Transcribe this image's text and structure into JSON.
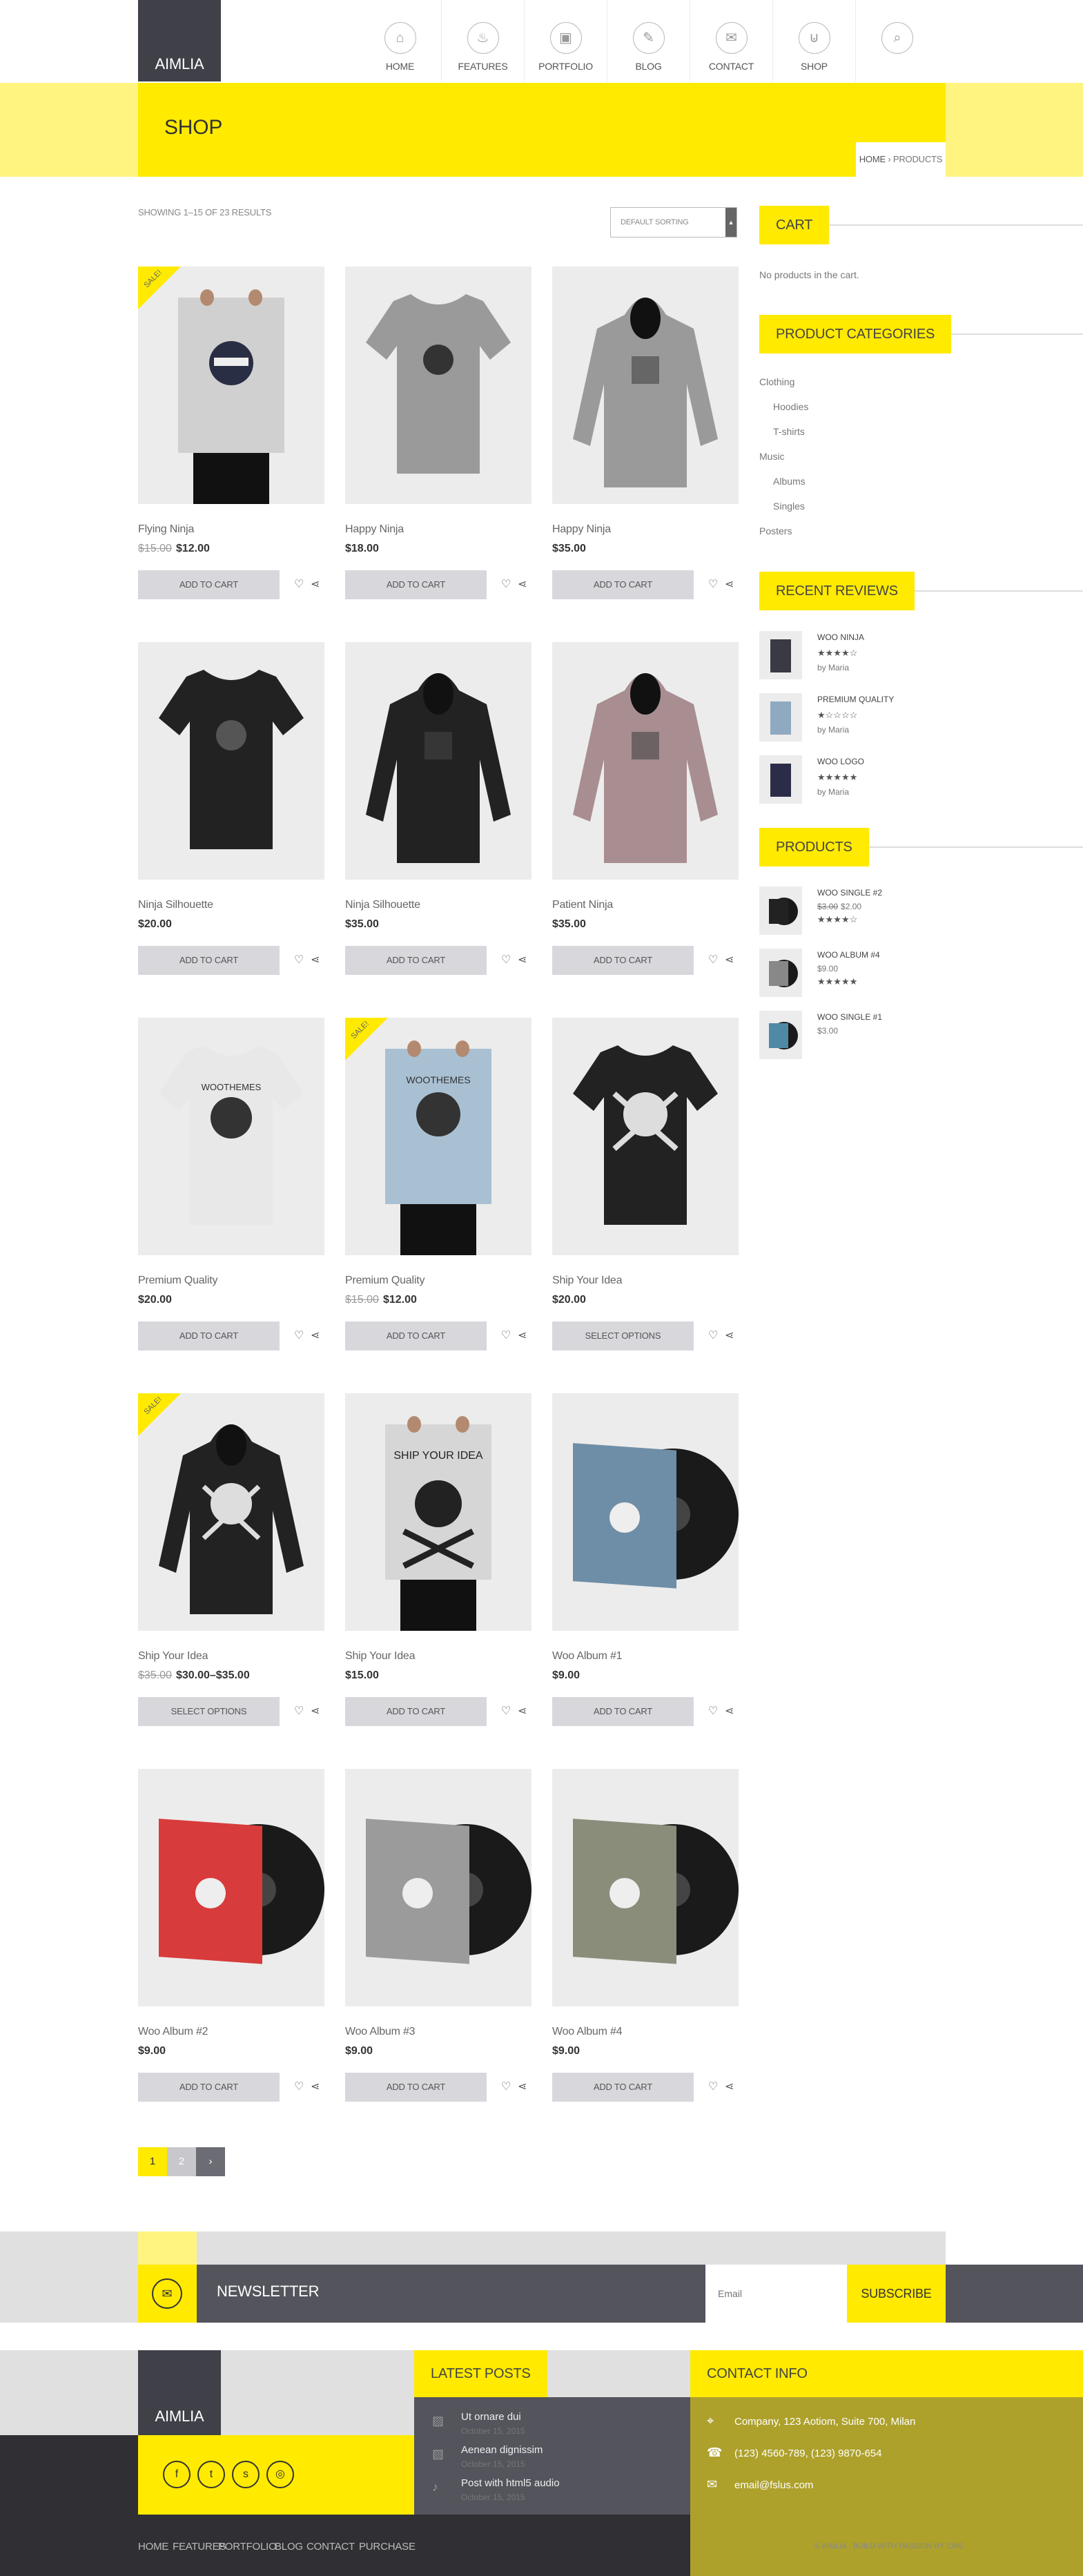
{
  "brand": "AIMLIA",
  "nav": [
    {
      "label": "HOME",
      "icon": "home-icon",
      "glyph": "⌂"
    },
    {
      "label": "FEATURES",
      "icon": "bulb-icon",
      "glyph": "♨"
    },
    {
      "label": "PORTFOLIO",
      "icon": "briefcase-icon",
      "glyph": "▣"
    },
    {
      "label": "BLOG",
      "icon": "blog-icon",
      "glyph": "✎"
    },
    {
      "label": "CONTACT",
      "icon": "mail-icon",
      "glyph": "✉"
    },
    {
      "label": "SHOP",
      "icon": "cart-icon",
      "glyph": "⊍"
    }
  ],
  "page_title": "SHOP",
  "breadcrumb": {
    "home": "HOME",
    "sep": " › ",
    "current": "PRODUCTS"
  },
  "results_text": "SHOWING 1–15 OF 23 RESULTS",
  "sort": {
    "selected": "DEFAULT SORTING"
  },
  "products": [
    {
      "name": "Flying Ninja",
      "old_price": "$15.00",
      "price": "$12.00",
      "sale": true,
      "button": "ADD TO CART",
      "kind": "poster-ninja"
    },
    {
      "name": "Happy Ninja",
      "old_price": "",
      "price": "$18.00",
      "sale": false,
      "button": "ADD TO CART",
      "kind": "tshirt-grey"
    },
    {
      "name": "Happy Ninja",
      "old_price": "",
      "price": "$35.00",
      "sale": false,
      "button": "ADD TO CART",
      "kind": "hoodie-grey"
    },
    {
      "name": "Ninja Silhouette",
      "old_price": "",
      "price": "$20.00",
      "sale": false,
      "button": "ADD TO CART",
      "kind": "tshirt-black"
    },
    {
      "name": "Ninja Silhouette",
      "old_price": "",
      "price": "$35.00",
      "sale": false,
      "button": "ADD TO CART",
      "kind": "hoodie-black"
    },
    {
      "name": "Patient Ninja",
      "old_price": "",
      "price": "$35.00",
      "sale": false,
      "button": "ADD TO CART",
      "kind": "hoodie-mauve"
    },
    {
      "name": "Premium Quality",
      "old_price": "",
      "price": "$20.00",
      "sale": false,
      "button": "ADD TO CART",
      "kind": "tshirt-white"
    },
    {
      "name": "Premium Quality",
      "old_price": "$15.00",
      "price": "$12.00",
      "sale": true,
      "button": "ADD TO CART",
      "kind": "poster-blue"
    },
    {
      "name": "Ship Your Idea",
      "old_price": "",
      "price": "$20.00",
      "sale": false,
      "button": "SELECT OPTIONS",
      "kind": "tshirt-black-skull"
    },
    {
      "name": "Ship Your Idea",
      "old_price": "$35.00",
      "price": "$30.00–$35.00",
      "sale": true,
      "button": "SELECT OPTIONS",
      "kind": "hoodie-black-skull"
    },
    {
      "name": "Ship Your Idea",
      "old_price": "",
      "price": "$15.00",
      "sale": false,
      "button": "ADD TO CART",
      "kind": "poster-skull"
    },
    {
      "name": "Woo Album #1",
      "old_price": "",
      "price": "$9.00",
      "sale": false,
      "button": "ADD TO CART",
      "kind": "album-blue"
    },
    {
      "name": "Woo Album #2",
      "old_price": "",
      "price": "$9.00",
      "sale": false,
      "button": "ADD TO CART",
      "kind": "album-red"
    },
    {
      "name": "Woo Album #3",
      "old_price": "",
      "price": "$9.00",
      "sale": false,
      "button": "ADD TO CART",
      "kind": "album-grey"
    },
    {
      "name": "Woo Album #4",
      "old_price": "",
      "price": "$9.00",
      "sale": false,
      "button": "ADD TO CART",
      "kind": "album-photo"
    }
  ],
  "sale_badge": "SALE!",
  "sidebar": {
    "cart_title": "CART",
    "cart_empty": "No products in the cart.",
    "categories_title": "PRODUCT CATEGORIES",
    "categories": [
      {
        "label": "Clothing",
        "indent": false
      },
      {
        "label": "Hoodies",
        "indent": true
      },
      {
        "label": "T-shirts",
        "indent": true
      },
      {
        "label": "Music",
        "indent": false
      },
      {
        "label": "Albums",
        "indent": true
      },
      {
        "label": "Singles",
        "indent": true
      },
      {
        "label": "Posters",
        "indent": false
      }
    ],
    "reviews_title": "RECENT REVIEWS",
    "reviews": [
      {
        "title": "WOO NINJA",
        "stars": "★★★★☆",
        "by": "by Maria"
      },
      {
        "title": "PREMIUM QUALITY",
        "stars": "★☆☆☆☆",
        "by": "by Maria"
      },
      {
        "title": "WOO LOGO",
        "stars": "★★★★★",
        "by": "by Maria"
      }
    ],
    "products_title": "PRODUCTS",
    "products": [
      {
        "title": "WOO SINGLE #2",
        "old_price": "$3.00",
        "price": "$2.00",
        "stars": "★★★★☆"
      },
      {
        "title": "WOO ALBUM #4",
        "old_price": "",
        "price": "$9.00",
        "stars": "★★★★★"
      },
      {
        "title": "WOO SINGLE #1",
        "old_price": "",
        "price": "$3.00",
        "stars": ""
      }
    ]
  },
  "pagination": [
    "1",
    "2",
    "›"
  ],
  "newsletter": {
    "title": "NEWSLETTER",
    "placeholder": "Email",
    "button": "SUBSCRIBE"
  },
  "footer": {
    "brand": "AIMLIA",
    "latest_posts_title": "LATEST POSTS",
    "posts": [
      {
        "title": "Ut ornare dui",
        "date": "October 15, 2015",
        "icon": "image-icon"
      },
      {
        "title": "Aenean dignissim",
        "date": "October 15, 2015",
        "icon": "image-icon"
      },
      {
        "title": "Post with html5 audio",
        "date": "October 15, 2015",
        "icon": "audio-icon"
      }
    ],
    "contact_title": "CONTACT INFO",
    "contact": [
      {
        "icon": "location-icon",
        "text": "Company, 123 Aotiom, Suite 700, Milan"
      },
      {
        "icon": "phone-icon",
        "text": "(123) 4560-789, (123) 9870-654"
      },
      {
        "icon": "mail-icon",
        "text": "email@fslus.com"
      }
    ],
    "nav": [
      "HOME",
      "FEATURES",
      "PORTFOLIO",
      "BLOG",
      "CONTACT",
      "PURCHASE"
    ],
    "copyright": "© AIMLIA · BUILD WITH PASSION BY CMS"
  },
  "colors": {
    "accent": "#ffea00",
    "dark": "#3f4048",
    "button": "#d8d8dc"
  }
}
